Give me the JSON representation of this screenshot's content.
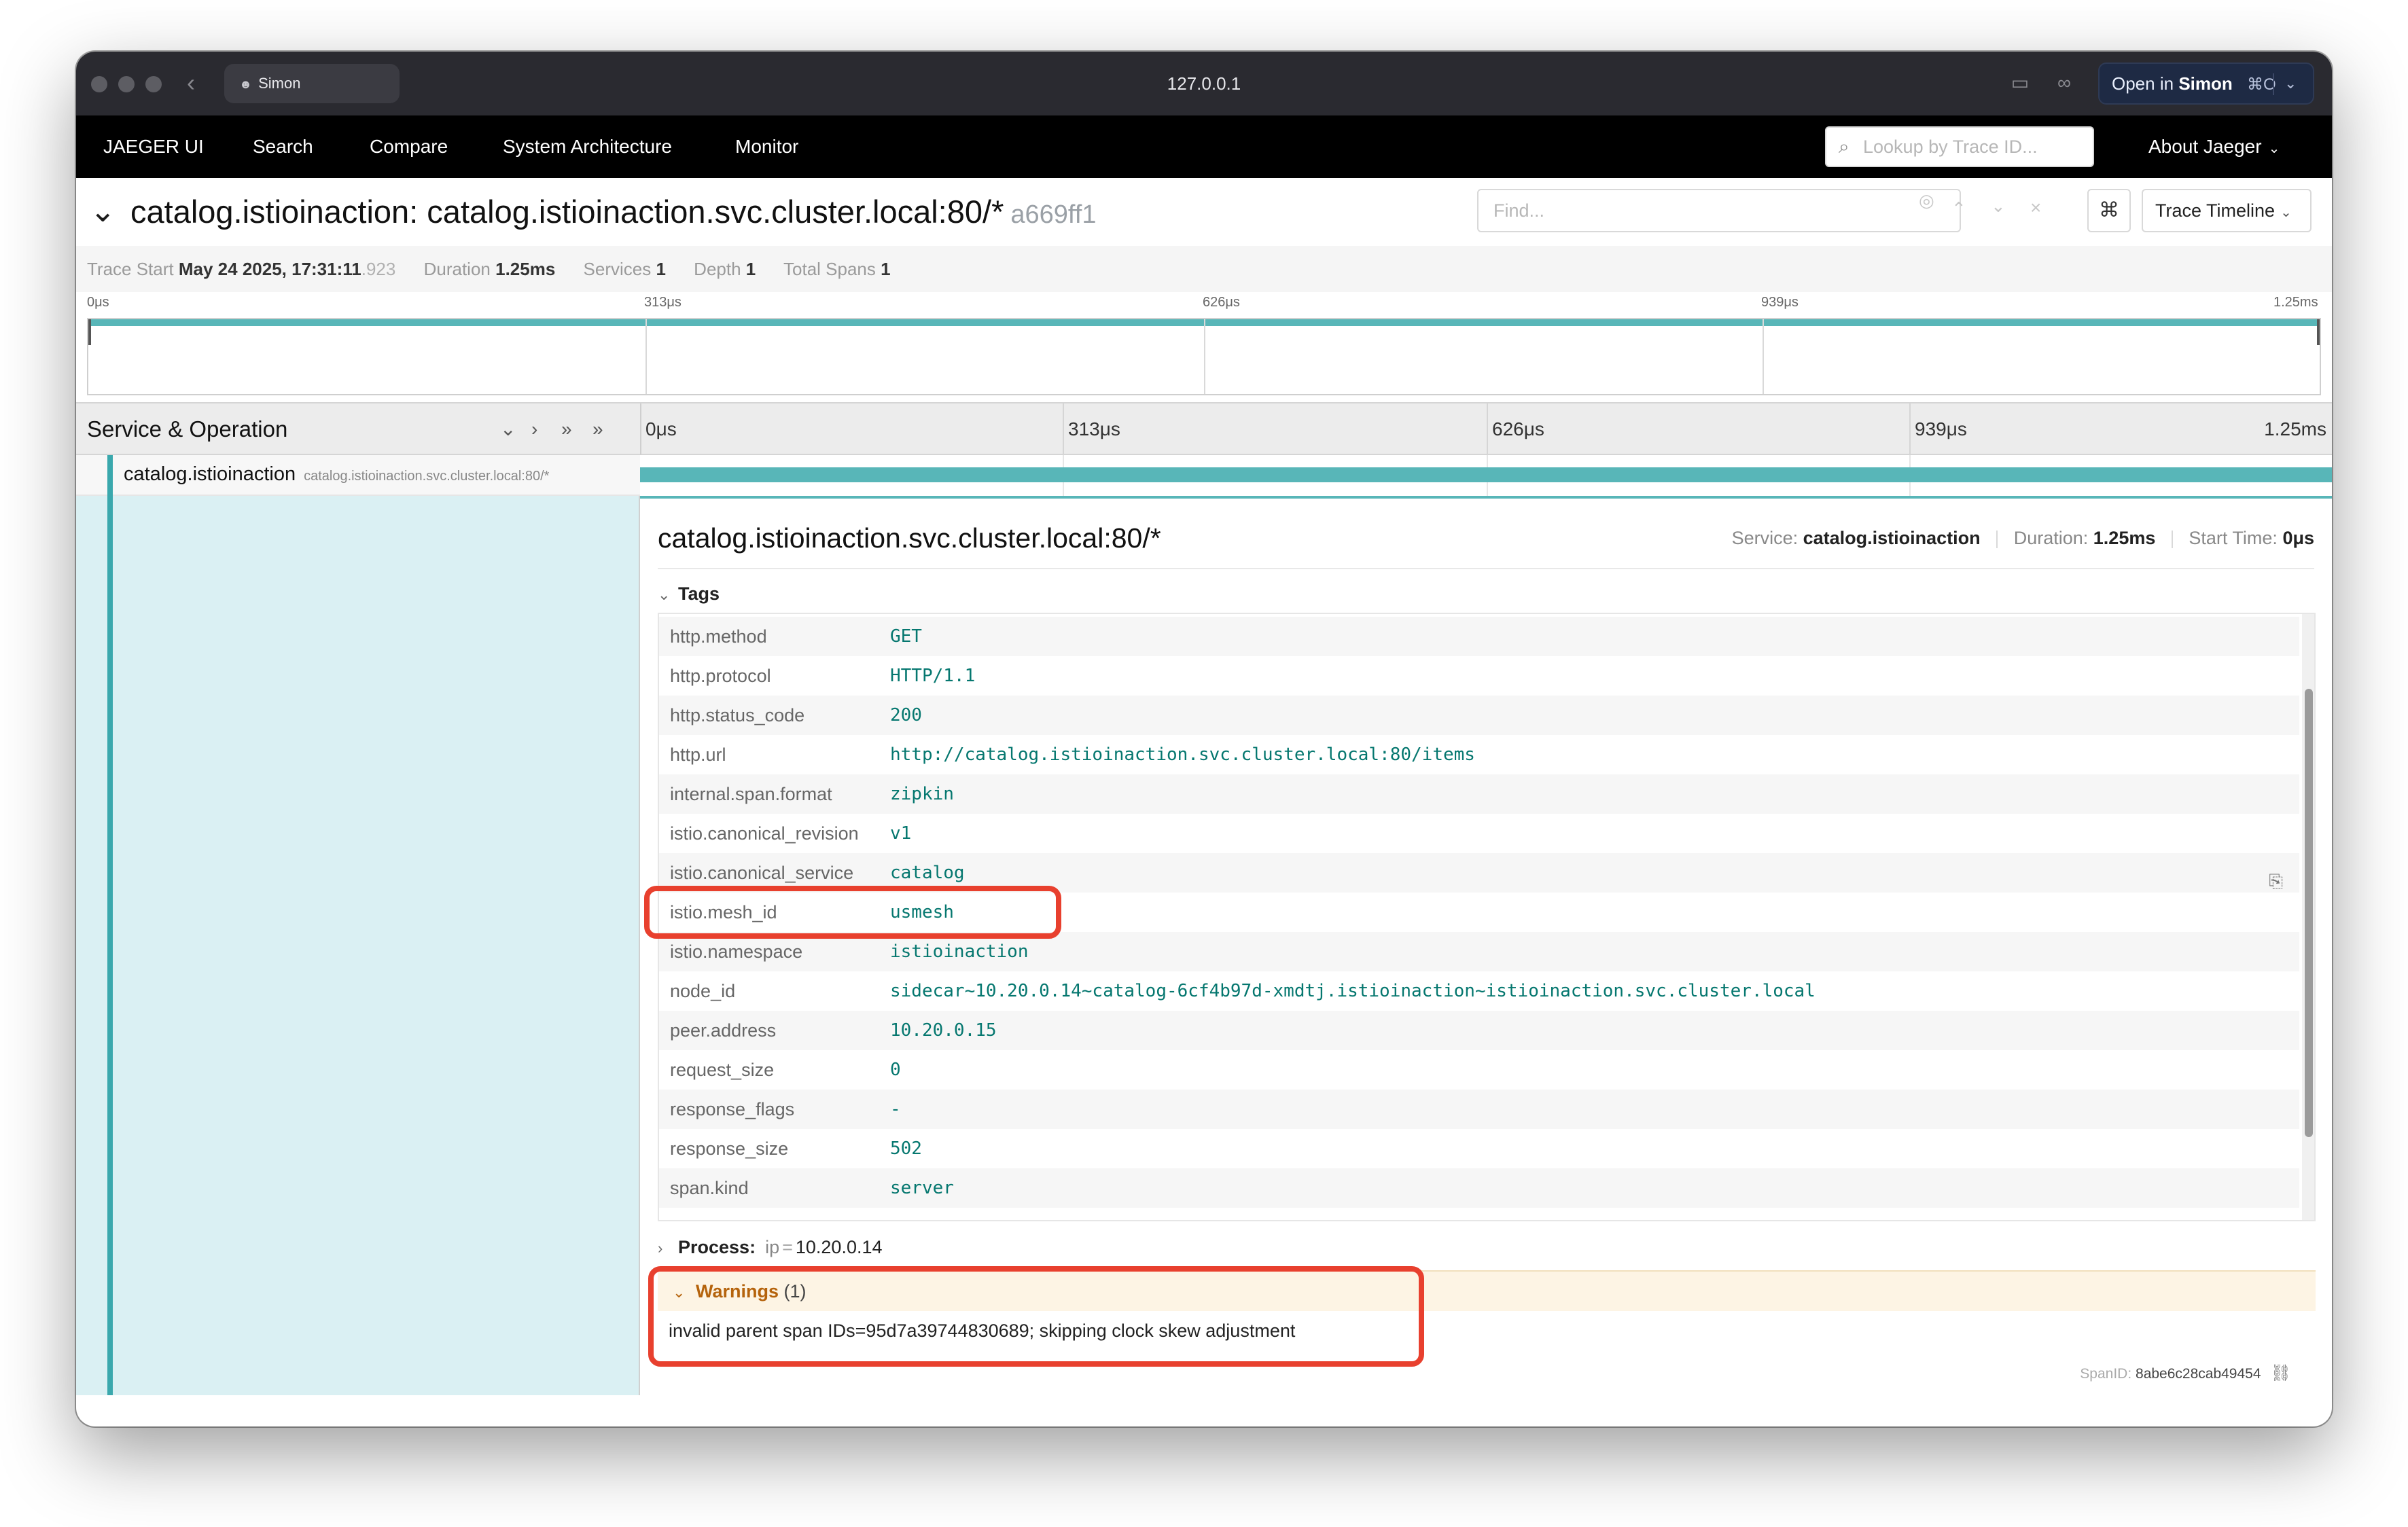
{
  "browser": {
    "profile": "Simon",
    "url": "127.0.0.1",
    "open_in_prefix": "Open in",
    "open_in_target": "Simon",
    "open_in_shortcut": "⌘O"
  },
  "nav": {
    "brand": "JAEGER UI",
    "items": [
      "Search",
      "Compare",
      "System Architecture",
      "Monitor"
    ],
    "lookup_placeholder": "Lookup by Trace ID...",
    "about": "About Jaeger"
  },
  "trace": {
    "title": "catalog.istioinaction: catalog.istioinaction.svc.cluster.local:80/*",
    "trace_id": "a669ff1",
    "find_placeholder": "Find...",
    "cmd_symbol": "⌘",
    "view_mode": "Trace Timeline",
    "meta": {
      "start_label": "Trace Start",
      "start_value": "May 24 2025, 17:31:11",
      "start_ms": ".923",
      "duration_label": "Duration",
      "duration_value": "1.25ms",
      "services_label": "Services",
      "services_value": "1",
      "depth_label": "Depth",
      "depth_value": "1",
      "spans_label": "Total Spans",
      "spans_value": "1"
    },
    "ticks": [
      "0μs",
      "313μs",
      "626μs",
      "939μs",
      "1.25ms"
    ]
  },
  "timeline": {
    "header_label": "Service & Operation",
    "span": {
      "service": "catalog.istioinaction",
      "operation": "catalog.istioinaction.svc.cluster.local:80/*"
    }
  },
  "detail": {
    "title": "catalog.istioinaction.svc.cluster.local:80/*",
    "service_label": "Service:",
    "service_value": "catalog.istioinaction",
    "duration_label": "Duration:",
    "duration_value": "1.25ms",
    "start_label": "Start Time:",
    "start_value": "0μs",
    "tags_label": "Tags",
    "tags": [
      {
        "key": "http.method",
        "value": "GET"
      },
      {
        "key": "http.protocol",
        "value": "HTTP/1.1"
      },
      {
        "key": "http.status_code",
        "value": "200"
      },
      {
        "key": "http.url",
        "value": "http://catalog.istioinaction.svc.cluster.local:80/items"
      },
      {
        "key": "internal.span.format",
        "value": "zipkin"
      },
      {
        "key": "istio.canonical_revision",
        "value": "v1"
      },
      {
        "key": "istio.canonical_service",
        "value": "catalog"
      },
      {
        "key": "istio.mesh_id",
        "value": "usmesh"
      },
      {
        "key": "istio.namespace",
        "value": "istioinaction"
      },
      {
        "key": "node_id",
        "value": "sidecar~10.20.0.14~catalog-6cf4b97d-xmdtj.istioinaction~istioinaction.svc.cluster.local"
      },
      {
        "key": "peer.address",
        "value": "10.20.0.15"
      },
      {
        "key": "request_size",
        "value": "0"
      },
      {
        "key": "response_flags",
        "value": "-"
      },
      {
        "key": "response_size",
        "value": "502"
      },
      {
        "key": "span.kind",
        "value": "server"
      }
    ],
    "process_label": "Process:",
    "process_key": "ip",
    "process_value": "10.20.0.14",
    "warnings_label": "Warnings",
    "warnings_count": "(1)",
    "warning_message": "invalid parent span IDs=95d7a39744830689; skipping clock skew adjustment",
    "spanid_label": "SpanID:",
    "spanid_value": "8abe6c28cab49454"
  },
  "colors": {
    "accent_teal": "#58b6b8",
    "tag_value": "#05776f",
    "warning": "#b5630c",
    "annotation_red": "#e8402e"
  }
}
